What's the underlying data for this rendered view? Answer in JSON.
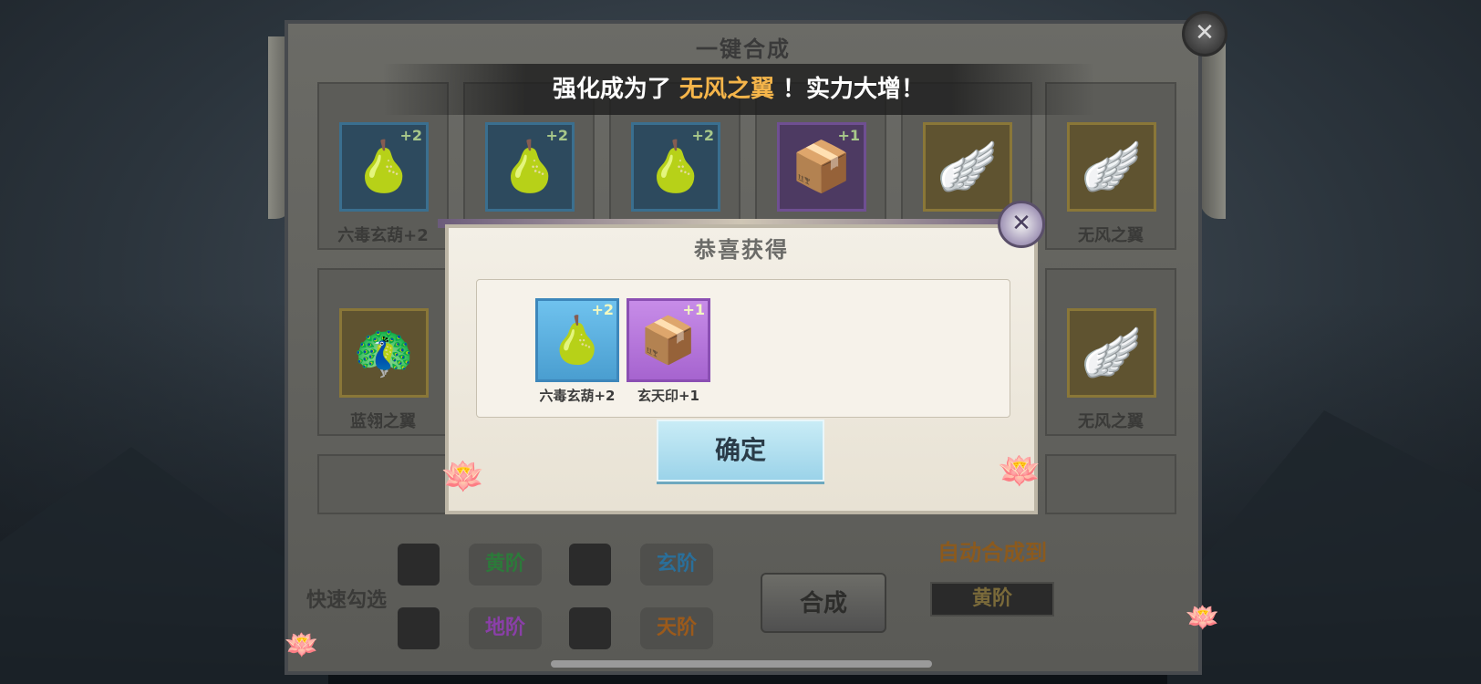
{
  "main_panel": {
    "title": "一键合成",
    "notice": {
      "prefix": "强化成为了 ",
      "highlight": "无风之翼",
      "suffix": " ！实力大增！"
    },
    "grid_items": [
      {
        "label": "六毒玄葫+2",
        "plus": "+2",
        "tier": "blue",
        "icon": "gourd-icon"
      },
      {
        "label": "",
        "plus": "+2",
        "tier": "blue",
        "icon": "gourd-icon"
      },
      {
        "label": "",
        "plus": "+2",
        "tier": "blue",
        "icon": "gourd-icon"
      },
      {
        "label": "",
        "plus": "+1",
        "tier": "purple",
        "icon": "seal-icon"
      },
      {
        "label": "",
        "plus": "",
        "tier": "gold",
        "icon": "wing-icon"
      },
      {
        "label": "无风之翼",
        "plus": "",
        "tier": "gold",
        "icon": "wing-icon"
      },
      {
        "label": "蓝翎之翼",
        "plus": "",
        "tier": "gold",
        "icon": "feather-wing-icon"
      },
      {
        "label": "无风之翼",
        "plus": "",
        "tier": "gold",
        "icon": "wing-icon"
      }
    ],
    "quick_select_label": "快速勾选",
    "tiers": [
      "黄阶",
      "玄阶",
      "地阶",
      "天阶"
    ],
    "synthesize_label": "合成",
    "auto_label": "自动合成到",
    "auto_value": "黄阶"
  },
  "modal": {
    "title": "恭喜获得",
    "rewards": [
      {
        "label": "六毒玄葫+2",
        "plus": "+2",
        "icon": "gourd-icon",
        "tier": "blue"
      },
      {
        "label": "玄天印+1",
        "plus": "+1",
        "icon": "seal-icon",
        "tier": "purple"
      }
    ],
    "confirm_label": "确定"
  },
  "colors": {
    "highlight": "#f5b54a",
    "tier_blue": "#4a9ed0",
    "tier_purple": "#a664cf",
    "tier_gold": "#8a7738"
  }
}
